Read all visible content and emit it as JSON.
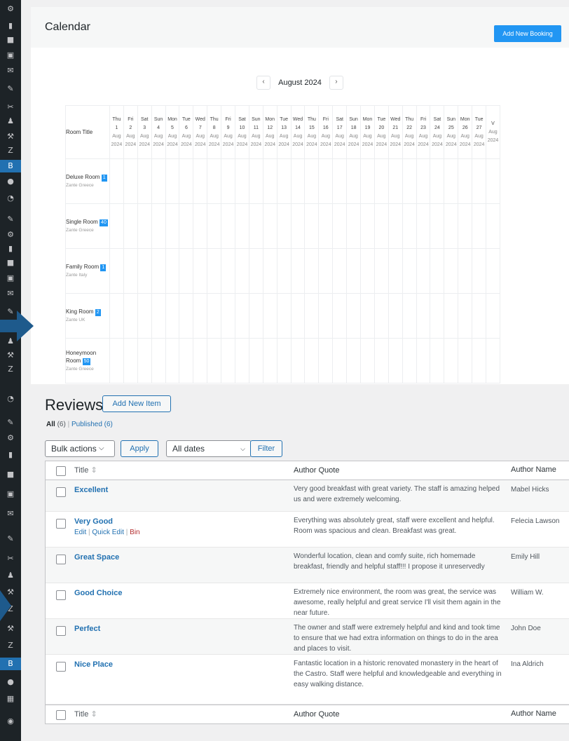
{
  "calendar": {
    "title": "Calendar",
    "add_button": "Add New Booking",
    "month": "August 2024",
    "prev": "‹",
    "next": "›",
    "room_title_header": "Room Title",
    "days": [
      {
        "dow": "Thu",
        "d": "1"
      },
      {
        "dow": "Fri",
        "d": "2"
      },
      {
        "dow": "Sat",
        "d": "3"
      },
      {
        "dow": "Sun",
        "d": "4"
      },
      {
        "dow": "Mon",
        "d": "5"
      },
      {
        "dow": "Tue",
        "d": "6"
      },
      {
        "dow": "Wed",
        "d": "7"
      },
      {
        "dow": "Thu",
        "d": "8"
      },
      {
        "dow": "Fri",
        "d": "9"
      },
      {
        "dow": "Sat",
        "d": "10"
      },
      {
        "dow": "Sun",
        "d": "11"
      },
      {
        "dow": "Mon",
        "d": "12"
      },
      {
        "dow": "Tue",
        "d": "13"
      },
      {
        "dow": "Wed",
        "d": "14"
      },
      {
        "dow": "Thu",
        "d": "15"
      },
      {
        "dow": "Fri",
        "d": "16"
      },
      {
        "dow": "Sat",
        "d": "17"
      },
      {
        "dow": "Sun",
        "d": "18"
      },
      {
        "dow": "Mon",
        "d": "19"
      },
      {
        "dow": "Tue",
        "d": "20"
      },
      {
        "dow": "Wed",
        "d": "21"
      },
      {
        "dow": "Thu",
        "d": "22"
      },
      {
        "dow": "Fri",
        "d": "23"
      },
      {
        "dow": "Sat",
        "d": "24"
      },
      {
        "dow": "Sun",
        "d": "25"
      },
      {
        "dow": "Mon",
        "d": "26"
      },
      {
        "dow": "Tue",
        "d": "27"
      },
      {
        "dow": "V",
        "d": ""
      }
    ],
    "month_short": "Aug",
    "year": "2024",
    "rooms": [
      {
        "name": "Deluxe Room",
        "count": "1",
        "location": "Zante Greece"
      },
      {
        "name": "Single Room",
        "count": "40",
        "location": "Zante Greece"
      },
      {
        "name": "Family Room",
        "count": "1",
        "location": "Zante Italy"
      },
      {
        "name": "King Room",
        "count": "2",
        "location": "Zante UK"
      },
      {
        "name": "Honeymoon Room",
        "count": "50",
        "location": "Zante Greece"
      }
    ]
  },
  "reviews": {
    "title": "Reviews",
    "add_button": "Add New Item",
    "filter_all": "All",
    "filter_all_count": "(6)",
    "filter_sep": "|",
    "filter_published": "Published (6)",
    "bulk_actions": "Bulk actions",
    "apply": "Apply",
    "all_dates": "All dates",
    "filter": "Filter",
    "columns": {
      "title": "Title",
      "quote": "Author Quote",
      "author": "Author Name"
    },
    "sort_icon": "⇕",
    "row_actions": {
      "edit": "Edit",
      "quick_edit": "Quick Edit",
      "bin": "Bin",
      "sep": "|"
    },
    "items": [
      {
        "title": "Excellent",
        "quote": "Very good breakfast with great variety. The staff is amazing helped us and were extremely welcoming.",
        "author": "Mabel Hicks"
      },
      {
        "title": "Very Good",
        "quote": "Everything was absolutely great, staff were excellent and helpful. Room was spacious and clean. Breakfast was great.",
        "author": "Felecia Lawson"
      },
      {
        "title": "Great Space",
        "quote": "Wonderful location, clean and comfy suite, rich homemade breakfast, friendly and helpful staff!!! I propose it unreservedly",
        "author": "Emily Hill"
      },
      {
        "title": "Good Choice",
        "quote": "Extremely nice environment, the room was great, the service was awesome, really helpful and great service I'll visit them again in the near future.",
        "author": "William W."
      },
      {
        "title": "Perfect",
        "quote": "The owner and staff were extremely helpful and kind and took time to ensure that we had extra information on things to do in the area and places to visit.",
        "author": "John Doe"
      },
      {
        "title": "Nice Place",
        "quote": "Fantastic location in a historic renovated monastery in the heart of the Castro. Staff were helpful and knowledgeable and everything in easy walking distance.",
        "author": "Ina Aldrich"
      }
    ]
  },
  "colors": {
    "admin_bar": "#1d2327",
    "accent": "#2271b1",
    "booking_blue": "#2196f3",
    "arrow": "#1e5a8c"
  }
}
